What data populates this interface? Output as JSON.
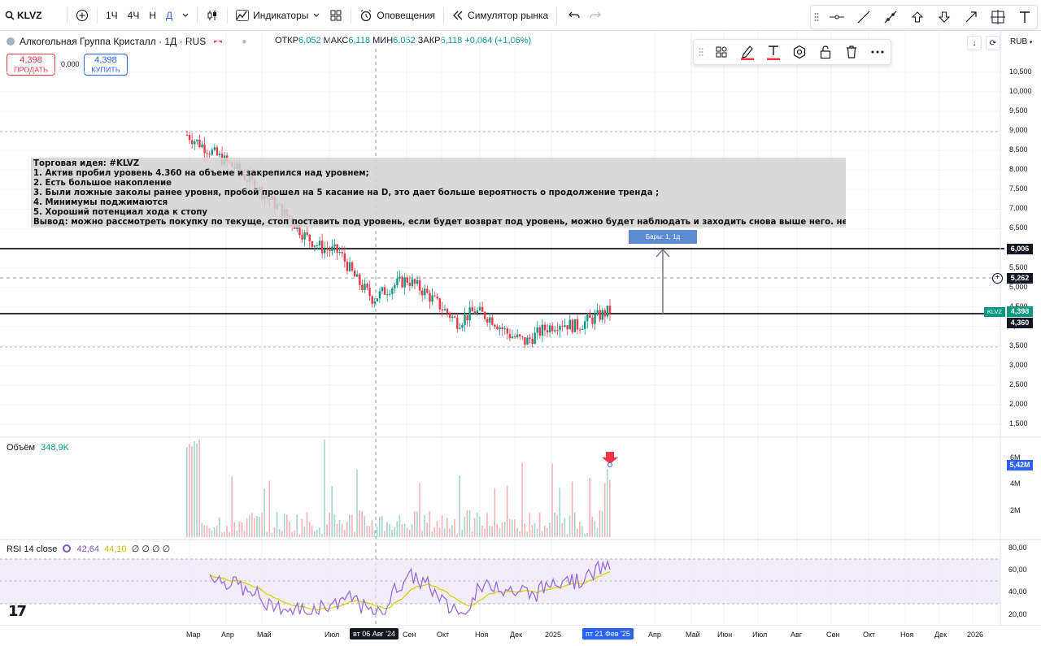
{
  "toolbar": {
    "symbol": "KLVZ",
    "timeframes": [
      "1Ч",
      "4Ч",
      "Н",
      "Д"
    ],
    "indicators_label": "Индикаторы",
    "alerts_label": "Оповещения",
    "replay_label": "Симулятор рынка"
  },
  "legend": {
    "title": "Алкогольная Группа Кристалл · 1Д · RUS",
    "open_label": "ОТКР",
    "open": "6,052",
    "high_label": "МАКС",
    "high": "6,118",
    "low_label": "МИН",
    "low": "6,052",
    "close_label": "ЗАКР",
    "close": "6,118",
    "change": "+0,064 (+1,06%)"
  },
  "trade": {
    "sell_price": "4,398",
    "sell_label": "ПРОДАТЬ",
    "spread": "0,000",
    "buy_price": "4,398",
    "buy_label": "КУПИТЬ"
  },
  "currency": "RUB",
  "idea_note": {
    "lines": [
      "Торговая идея: #KLVZ",
      "1. Актив пробил уровень 4.360 на объеме и закрепился над уровнем;",
      "2. Есть большое накопление",
      "3. Были ложные заколы ранее уровня, пробой прошел на 5 касание на D, это дает больше вероятность о продолжение тренда ;",
      "4. Минимумы поджимаются",
      "5. Хороший потенциал хода к стопу",
      "Вывод: можно рассмотреть покупку по текуще, стоп поставить под уровень, если будет возврат под уровень, можно будет наблюдать и заходить снова выше него. не ИИР"
    ]
  },
  "measure_label": "Бары: 1, 1д",
  "price_scale": [
    "10,500",
    "10,000",
    "9,500",
    "9,000",
    "8,500",
    "8,000",
    "7,500",
    "7,000",
    "6,500",
    "6,000",
    "5,500",
    "5,000",
    "4,500",
    "4,000",
    "3,500",
    "3,000",
    "2,500",
    "2,000",
    "1,500"
  ],
  "price_tags": {
    "level_high": "6,006",
    "crosshair": "5,262",
    "symbol_tag": "KLVZ",
    "last_price": "4,398",
    "level_low": "4,360"
  },
  "volume": {
    "label": "Объём",
    "value": "348,9K",
    "scale": [
      "6M",
      "4M",
      "2M"
    ],
    "last": "5,42M"
  },
  "rsi": {
    "label": "RSI 14 close",
    "value": "42,64",
    "ma": "44,10",
    "extra": "∅ ∅ ∅ ∅",
    "scale": [
      "80,00",
      "60,00",
      "40,00",
      "20,00"
    ]
  },
  "time_axis": [
    "Мар",
    "Апр",
    "Май",
    "Июл",
    "Сен",
    "Окт",
    "Ноя",
    "Дек",
    "2025",
    "Апр",
    "Май",
    "Июн",
    "Июл",
    "Авг",
    "Сен",
    "Окт",
    "Ноя",
    "Дек",
    "2026"
  ],
  "time_highlights": {
    "crosshair": "вт 06 Авг '24",
    "selected": "пт 21 Фев '25"
  },
  "chart_data": {
    "type": "candlestick",
    "series": [
      {
        "name": "KLVZ",
        "approx_close_path": [
          8.9,
          8.6,
          8.3,
          8.0,
          7.6,
          7.2,
          6.8,
          6.3,
          6.0,
          5.9,
          5.2,
          4.7,
          5.0,
          5.2,
          4.9,
          4.5,
          4.1,
          4.4,
          4.2,
          3.8,
          3.6,
          3.9,
          4.1,
          4.0,
          4.2,
          4.4
        ]
      }
    ],
    "levels": [
      6.006,
      4.36
    ],
    "ylim": [
      1.0,
      11.0
    ]
  },
  "colors": {
    "up": "#089981",
    "down": "#f23645",
    "rsi": "#7e57c2",
    "rsi_ma": "#e6e600",
    "accent": "#2962ff"
  }
}
